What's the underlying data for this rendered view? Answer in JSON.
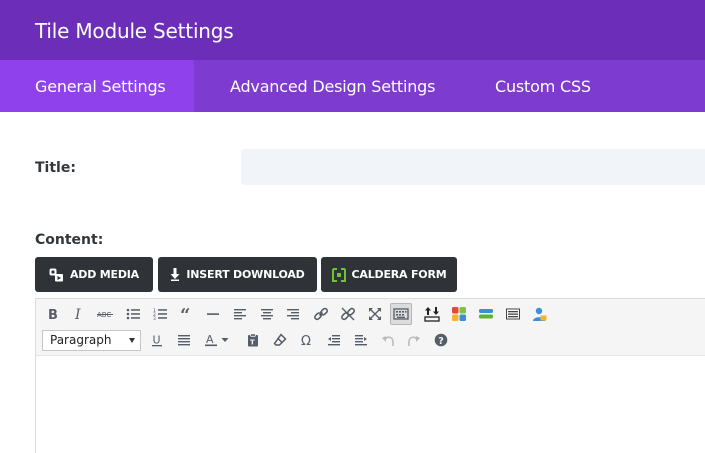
{
  "header": {
    "title": "Tile Module Settings"
  },
  "tabs": [
    {
      "label": "General Settings",
      "active": true
    },
    {
      "label": "Advanced Design Settings",
      "active": false
    },
    {
      "label": "Custom CSS",
      "active": false
    }
  ],
  "form": {
    "title_label": "Title:",
    "title_value": "",
    "content_label": "Content:"
  },
  "media_buttons": [
    {
      "label": "ADD MEDIA",
      "icon": "add-media-icon"
    },
    {
      "label": "INSERT DOWNLOAD",
      "icon": "download-arrow-icon"
    },
    {
      "label": "CALDERA FORM",
      "icon": "caldera-form-icon"
    }
  ],
  "editor": {
    "format_select": "Paragraph",
    "toolbar_row1": [
      "bold",
      "italic",
      "strikethrough",
      "bullet-list",
      "numbered-list",
      "blockquote",
      "horizontal-line",
      "align-left",
      "align-center",
      "align-right",
      "insert-link",
      "remove-link",
      "fullscreen",
      "toolbar-toggle",
      "upload",
      "colored-blocks",
      "layer-stack",
      "page-break",
      "user-badge"
    ],
    "toolbar_row2": [
      "underline",
      "justify",
      "text-color",
      "paste-text",
      "clear-formatting",
      "special-character",
      "outdent",
      "indent",
      "undo",
      "redo",
      "help"
    ],
    "colors": {
      "header": "#6c2eb9",
      "tabs": "#7e3bd0",
      "active_tab": "#8f42ec",
      "button_dark": "#2f3237",
      "caldera_green": "#6dc23a"
    }
  }
}
